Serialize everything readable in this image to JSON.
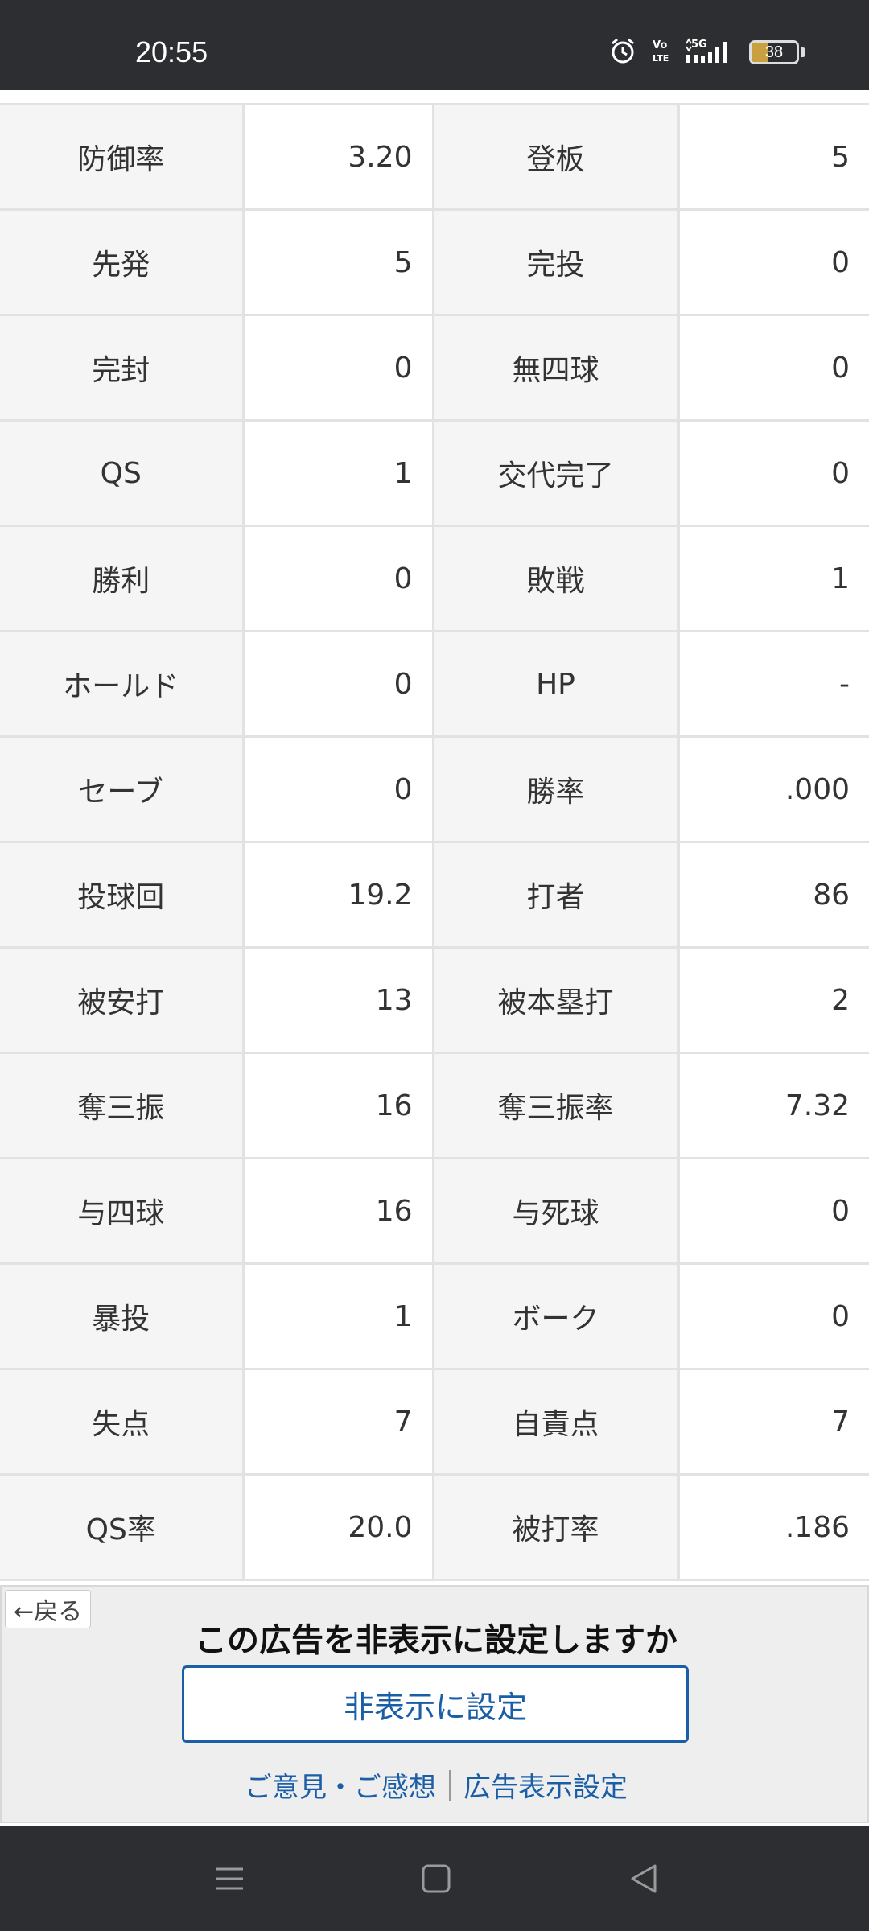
{
  "status_bar": {
    "time": "20:55",
    "battery_level": "38",
    "battery_fraction": 0.38,
    "icons": [
      "alarm-icon",
      "volte-icon",
      "5g-icon",
      "signal-icon",
      "battery-icon"
    ]
  },
  "stats": {
    "rows": [
      [
        {
          "label": "防御率",
          "value": "3.20"
        },
        {
          "label": "登板",
          "value": "5"
        }
      ],
      [
        {
          "label": "先発",
          "value": "5"
        },
        {
          "label": "完投",
          "value": "0"
        }
      ],
      [
        {
          "label": "完封",
          "value": "0"
        },
        {
          "label": "無四球",
          "value": "0"
        }
      ],
      [
        {
          "label": "QS",
          "value": "1"
        },
        {
          "label": "交代完了",
          "value": "0"
        }
      ],
      [
        {
          "label": "勝利",
          "value": "0"
        },
        {
          "label": "敗戦",
          "value": "1"
        }
      ],
      [
        {
          "label": "ホールド",
          "value": "0"
        },
        {
          "label": "HP",
          "value": "-"
        }
      ],
      [
        {
          "label": "セーブ",
          "value": "0"
        },
        {
          "label": "勝率",
          "value": ".000"
        }
      ],
      [
        {
          "label": "投球回",
          "value": "19.2"
        },
        {
          "label": "打者",
          "value": "86"
        }
      ],
      [
        {
          "label": "被安打",
          "value": "13"
        },
        {
          "label": "被本塁打",
          "value": "2"
        }
      ],
      [
        {
          "label": "奪三振",
          "value": "16"
        },
        {
          "label": "奪三振率",
          "value": "7.32"
        }
      ],
      [
        {
          "label": "与四球",
          "value": "16"
        },
        {
          "label": "与死球",
          "value": "0"
        }
      ],
      [
        {
          "label": "暴投",
          "value": "1"
        },
        {
          "label": "ボーク",
          "value": "0"
        }
      ],
      [
        {
          "label": "失点",
          "value": "7"
        },
        {
          "label": "自責点",
          "value": "7"
        }
      ],
      [
        {
          "label": "QS率",
          "value": "20.0"
        },
        {
          "label": "被打率",
          "value": ".186"
        }
      ]
    ]
  },
  "ad": {
    "back_label": "←戻る",
    "title": "この広告を非表示に設定しますか",
    "hide_button": "非表示に設定",
    "feedback_link": "ご意見・ご感想",
    "settings_link": "広告表示設定"
  },
  "nav_bar": {
    "icons": [
      "menu-icon",
      "home-icon",
      "back-icon"
    ]
  },
  "colors": {
    "system_bar": "#2d2e31",
    "label_bg": "#f5f5f5",
    "border": "#e2e2e2",
    "link_blue": "#1a5ea8",
    "battery": "#c8a040"
  }
}
